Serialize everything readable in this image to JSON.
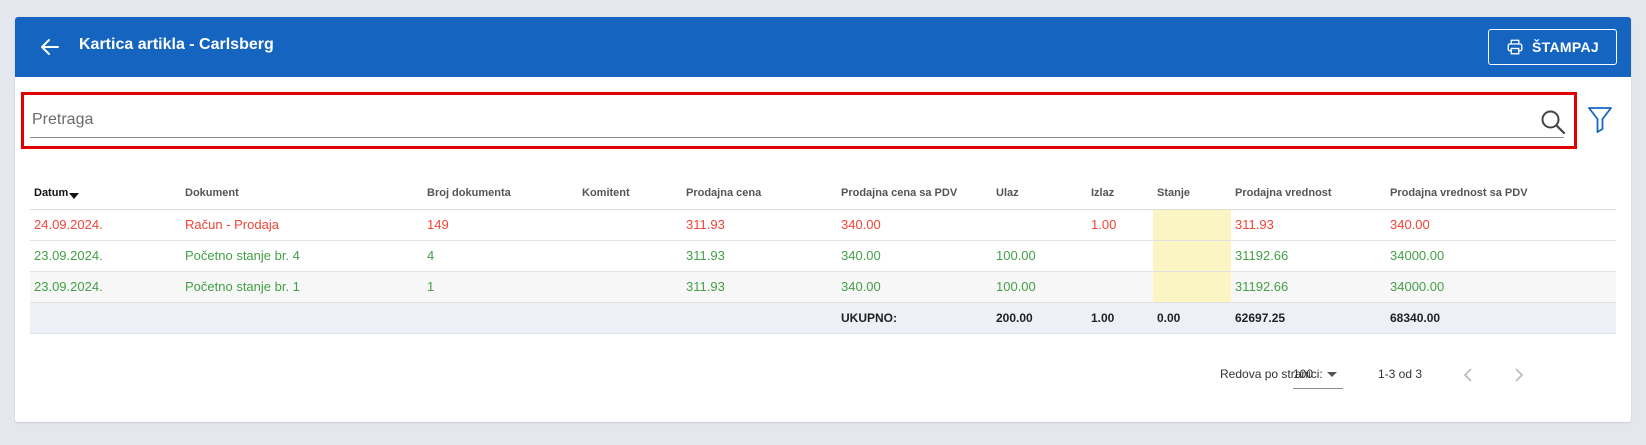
{
  "header": {
    "title": "Kartica artikla - Carlsberg",
    "print_label": "ŠTAMPAJ",
    "back_icon": "arrow-left-icon",
    "print_icon": "printer-icon"
  },
  "search": {
    "placeholder": "Pretraga",
    "value": ""
  },
  "table": {
    "columns": [
      "Datum",
      "Dokument",
      "Broj dokumenta",
      "Komitent",
      "Prodajna cena",
      "Prodajna cena sa PDV",
      "Ulaz",
      "Izlaz",
      "Stanje",
      "Prodajna vrednost",
      "Prodajna vrednost sa PDV"
    ],
    "sorted_column": "Datum",
    "sort_direction": "desc",
    "rows": [
      {
        "datum": "24.09.2024.",
        "dokument": "Račun - Prodaja",
        "broj": "149",
        "komitent": "",
        "cena": "311.93",
        "cena_pdv": "340.00",
        "ulaz": "",
        "izlaz": "1.00",
        "stanje": "",
        "vrednost": "311.93",
        "vrednost_pdv": "340.00"
      },
      {
        "datum": "23.09.2024.",
        "dokument": "Početno stanje br. 4",
        "broj": "4",
        "komitent": "",
        "cena": "311.93",
        "cena_pdv": "340.00",
        "ulaz": "100.00",
        "izlaz": "",
        "stanje": "",
        "vrednost": "31192.66",
        "vrednost_pdv": "34000.00"
      },
      {
        "datum": "23.09.2024.",
        "dokument": "Početno stanje br. 1",
        "broj": "1",
        "komitent": "",
        "cena": "311.93",
        "cena_pdv": "340.00",
        "ulaz": "100.00",
        "izlaz": "",
        "stanje": "",
        "vrednost": "31192.66",
        "vrednost_pdv": "34000.00"
      }
    ],
    "totals": {
      "label": "UKUPNO:",
      "ulaz": "200.00",
      "izlaz": "1.00",
      "stanje": "0.00",
      "vrednost": "62697.25",
      "vrednost_pdv": "68340.00"
    }
  },
  "pagination": {
    "rows_label": "Redova po stranici:",
    "rows_per_page": "100",
    "range": "1-3 od 3"
  },
  "colors": {
    "header_bg": "#1565c0",
    "outgoing_row": "#f44336",
    "incoming_row": "#43a047",
    "stanje_highlight": "#fbf5c4",
    "search_highlight_border": "#e00000"
  }
}
